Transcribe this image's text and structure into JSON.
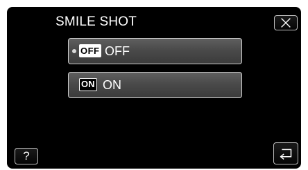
{
  "menu": {
    "title": "SMILE SHOT"
  },
  "options": [
    {
      "badge": "OFF",
      "label": "OFF",
      "selected": true
    },
    {
      "badge": "ON",
      "label": "ON",
      "selected": false
    }
  ],
  "buttons": {
    "close_icon": "close-icon",
    "help_symbol": "?",
    "back_icon": "return-arrow-icon"
  },
  "colors": {
    "background": "#000000",
    "option_fill": "#4a4a4a",
    "border": "#d0d0d0",
    "text": "#ffffff"
  }
}
